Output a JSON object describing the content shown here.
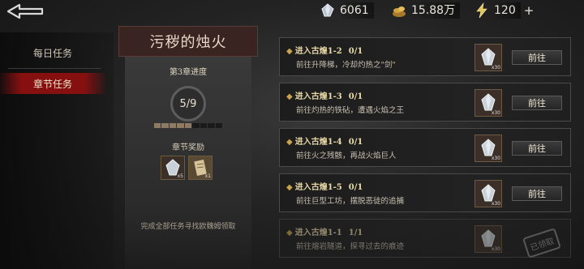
{
  "currencies": [
    {
      "icon": "diamond-crystal-icon",
      "value": "6061"
    },
    {
      "icon": "gold-pile-icon",
      "value": "15.88万"
    },
    {
      "icon": "lightning-energy-icon",
      "value": "120"
    }
  ],
  "energy_add_symbol": "+",
  "sidebar": {
    "items": [
      {
        "label": "每日任务",
        "active": false
      },
      {
        "label": "章节任务",
        "active": true
      }
    ]
  },
  "chapter": {
    "title": "污秽的烛火",
    "progress_title": "第3章进度",
    "progress_text": "5/9",
    "progress_done": 5,
    "progress_total": 9,
    "reward_title": "章节奖励",
    "rewards": [
      {
        "icon": "crystal-reward-icon",
        "qty": "x5"
      },
      {
        "icon": "scroll-reward-icon",
        "qty": "x1"
      }
    ],
    "footer_note": "完成全部任务寻找欧魏姆领取"
  },
  "tasks": [
    {
      "title": "进入古煌1-2",
      "count": "0/1",
      "desc": "前往升降梯，冷却灼热之\"剑\"",
      "button": "前往",
      "reward_qty": "x30",
      "done": false
    },
    {
      "title": "进入古煌1-3",
      "count": "0/1",
      "desc": "前往灼热的铁砧，遭遇火焰之王",
      "button": "前往",
      "reward_qty": "x30",
      "done": false
    },
    {
      "title": "进入古煌1-4",
      "count": "0/1",
      "desc": "前往火之残骸，再战火焰巨人",
      "button": "前往",
      "reward_qty": "x30",
      "done": false
    },
    {
      "title": "进入古煌1-5",
      "count": "0/1",
      "desc": "前往巨型工坊，摆脱恶徒的追捕",
      "button": "前往",
      "reward_qty": "x30",
      "done": false
    },
    {
      "title": "进入古煌1-1",
      "count": "1/1",
      "desc": "前往熔岩隧道，探寻过去的痕迹",
      "button": "",
      "reward_qty": "x30",
      "done": true,
      "stamp": "已领取"
    }
  ],
  "colors": {
    "accent_red": "#8c1010",
    "task_title": "#e9d9a8",
    "progress_segment": "#8f7a63"
  }
}
